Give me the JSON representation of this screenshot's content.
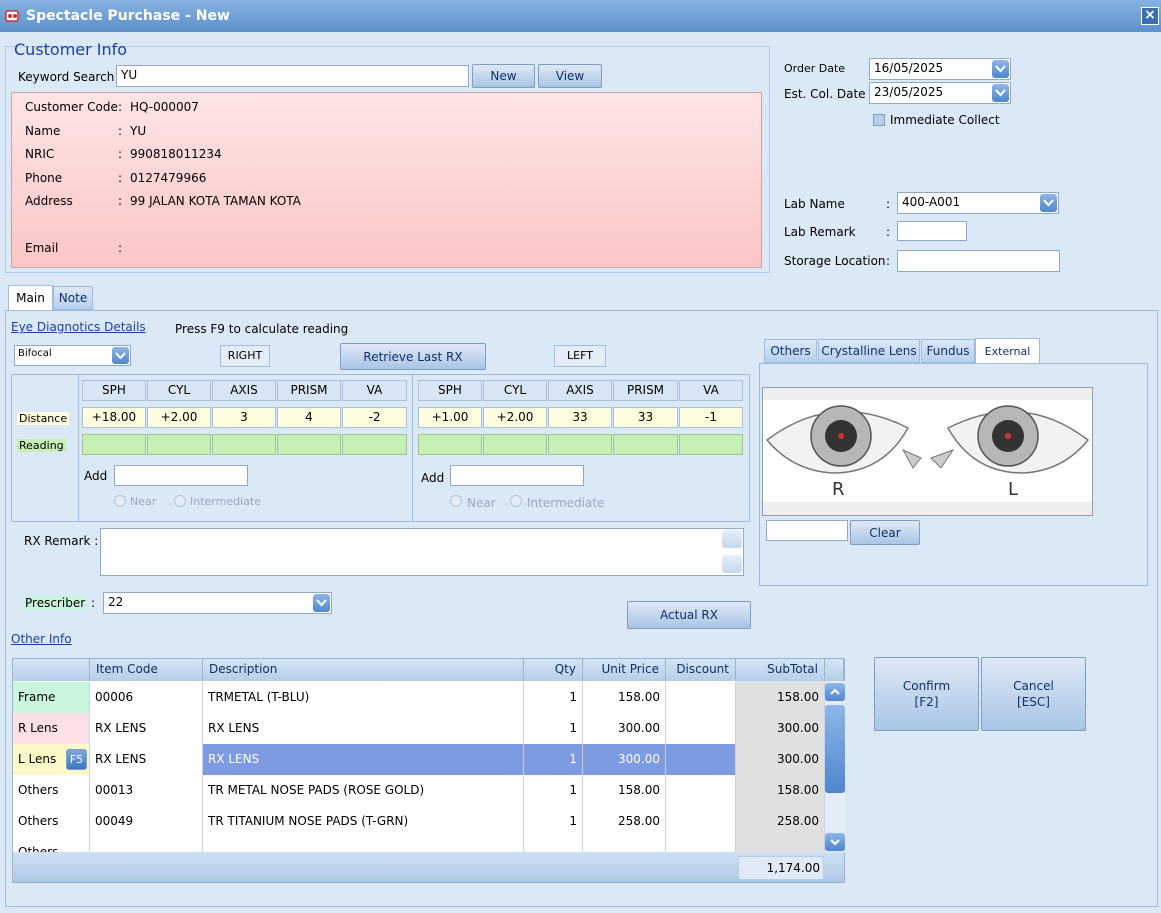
{
  "window": {
    "title": "Spectacle Purchase - New",
    "close": "×"
  },
  "customer": {
    "heading": "Customer Info",
    "keyword_label": "Keyword Search",
    "keyword_value": "YU",
    "new_button": "New",
    "view_button": "View",
    "fields": [
      {
        "label": "Customer Code",
        "value": "HQ-000007"
      },
      {
        "label": "Name",
        "value": "YU"
      },
      {
        "label": "NRIC",
        "value": "990818011234"
      },
      {
        "label": "Phone",
        "value": "0127479966"
      },
      {
        "label": "Address",
        "value": "99 JALAN KOTA TAMAN KOTA"
      },
      {
        "label": "Email",
        "value": ""
      }
    ]
  },
  "order": {
    "order_date_label": "Order Date",
    "order_date": "16/05/2025",
    "est_col_label": "Est. Col. Date",
    "est_col_date": "23/05/2025",
    "immediate_collect": "Immediate Collect",
    "lab_name_label": "Lab Name",
    "lab_name": "400-A001",
    "lab_remark_label": "Lab Remark",
    "lab_remark": "",
    "storage_label": "Storage Location",
    "storage": "",
    "colon": ":"
  },
  "tabs": {
    "main": "Main",
    "note": "Note"
  },
  "eye": {
    "heading": "Eye Diagnotics Details",
    "hint": "Press F9 to calculate reading",
    "lens_type": "Bifocal",
    "right_label": "RIGHT",
    "left_label": "LEFT",
    "retrieve_button": "Retrieve Last RX",
    "distance_label": "Distance",
    "reading_label": "Reading",
    "columns": [
      "SPH",
      "CYL",
      "AXIS",
      "PRISM",
      "VA"
    ],
    "right_distance": [
      "+18.00",
      "+2.00",
      "3",
      "4",
      "-2"
    ],
    "left_distance": [
      "+1.00",
      "+2.00",
      "33",
      "33",
      "-1"
    ],
    "add_label": "Add",
    "near_label": "Near",
    "intermediate_label": "Intermediate",
    "rx_remark_label": "RX Remark :",
    "prescriber_label": "Prescriber",
    "prescriber_value": "22",
    "actual_rx_button": "Actual RX"
  },
  "image_tabs": {
    "tabs": [
      "Others",
      "Crystalline Lens",
      "Fundus",
      "External"
    ],
    "active": "External",
    "clear_button": "Clear",
    "eye_r": "R",
    "eye_l": "L"
  },
  "other_info": {
    "heading": "Other Info",
    "columns": [
      "Item Code",
      "Description",
      "Qty",
      "Unit Price",
      "Discount",
      "SubTotal"
    ],
    "rows": [
      {
        "type": "Frame",
        "code": "00006",
        "desc": "TRMETAL (T-BLU)",
        "qty": "1",
        "price": "158.00",
        "discount": "",
        "subtotal": "158.00"
      },
      {
        "type": "R Lens",
        "code": "RX LENS",
        "desc": "RX LENS",
        "qty": "1",
        "price": "300.00",
        "discount": "",
        "subtotal": "300.00"
      },
      {
        "type": "L Lens",
        "code": "RX LENS",
        "desc": "RX LENS",
        "qty": "1",
        "price": "300.00",
        "discount": "",
        "subtotal": "300.00"
      },
      {
        "type": "Others",
        "code": "00013",
        "desc": "TR METAL NOSE PADS (ROSE GOLD)",
        "qty": "1",
        "price": "158.00",
        "discount": "",
        "subtotal": "158.00"
      },
      {
        "type": "Others",
        "code": "00049",
        "desc": "TR TITANIUM NOSE PADS (T-GRN)",
        "qty": "1",
        "price": "258.00",
        "discount": "",
        "subtotal": "258.00"
      },
      {
        "type": "Others",
        "code": "",
        "desc": "",
        "qty": "",
        "price": "",
        "discount": "",
        "subtotal": ""
      }
    ],
    "f5": "F5",
    "total": "1,174.00"
  },
  "actions": {
    "confirm": "Confirm",
    "confirm_key": "[F2]",
    "cancel": "Cancel",
    "cancel_key": "[ESC]"
  },
  "colors": {
    "accent": "#1a3ea8",
    "highlight_row": "#7d9be0",
    "frame_row": "#c8f5dc",
    "rlens_row": "#fde0e6",
    "llens_row": "#fdf8c8"
  }
}
